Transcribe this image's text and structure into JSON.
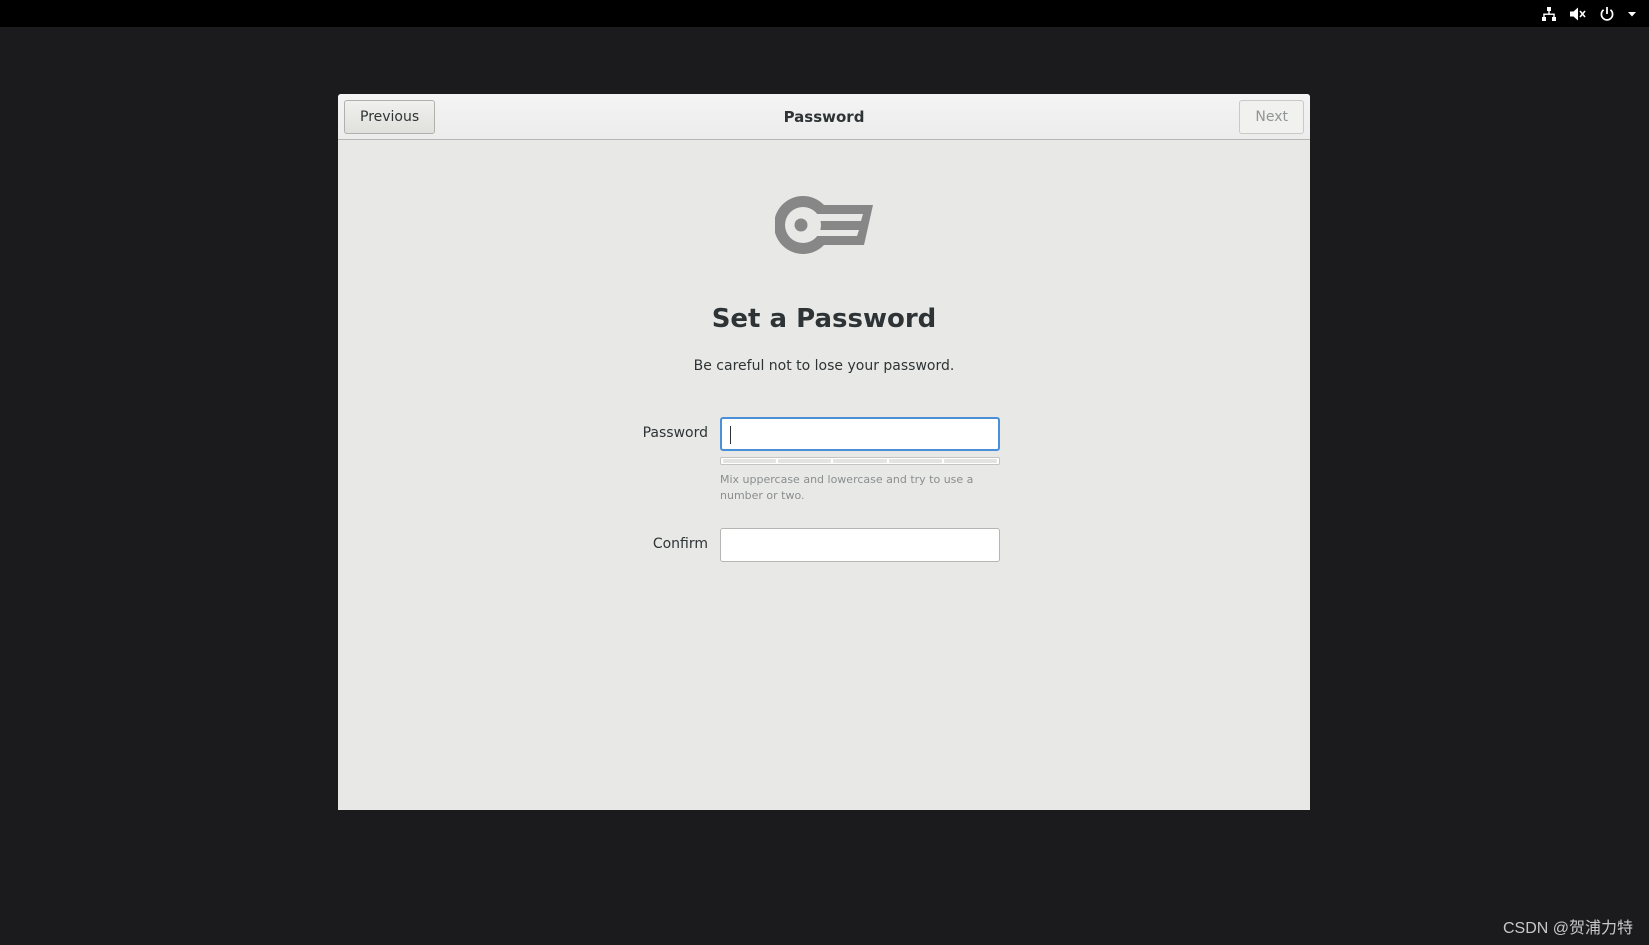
{
  "window": {
    "title": "Password",
    "previous_label": "Previous",
    "next_label": "Next"
  },
  "page": {
    "heading": "Set a Password",
    "subtitle": "Be careful not to lose your password.",
    "password_label": "Password",
    "confirm_label": "Confirm",
    "password_value": "",
    "confirm_value": "",
    "hint": "Mix uppercase and lowercase and try to use a number or two.",
    "strength_level": 0
  },
  "tray": {
    "icons": [
      "network-icon",
      "volume-muted-icon",
      "power-icon",
      "chevron-down-icon"
    ]
  },
  "watermark": "CSDN @贺浦力特",
  "colors": {
    "focus": "#4a90d9",
    "text": "#2e3436",
    "background": "#1b1b1d"
  }
}
